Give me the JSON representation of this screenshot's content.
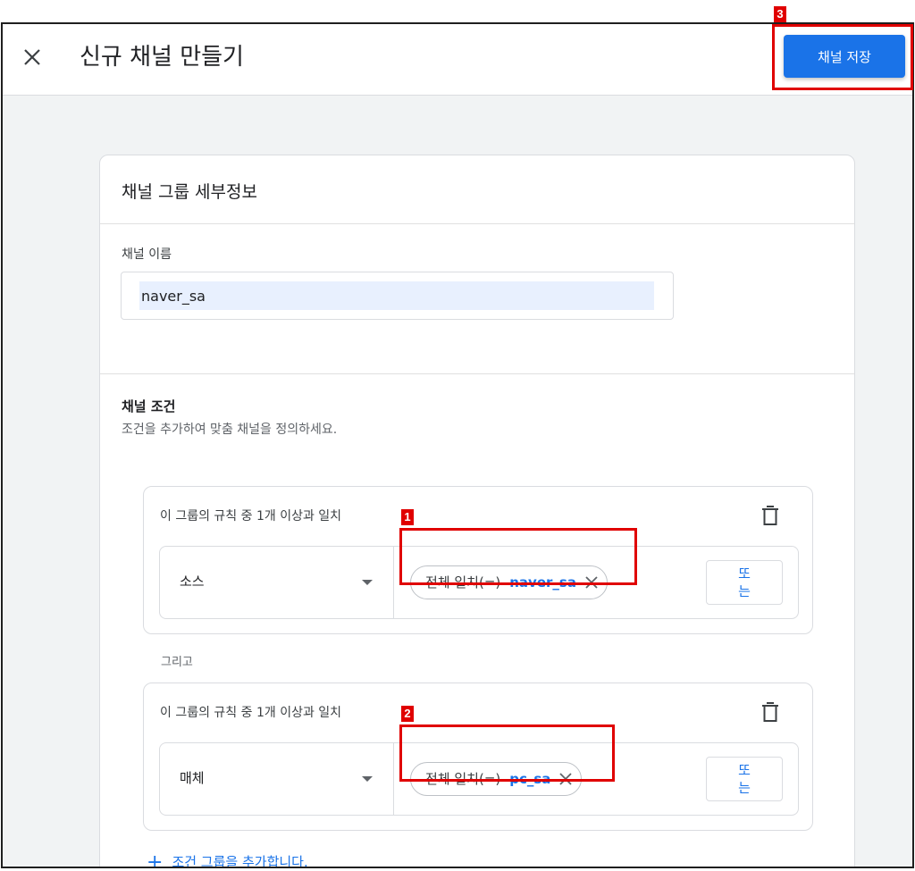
{
  "header": {
    "title": "신규 채널 만들기",
    "save_label": "채널 저장"
  },
  "card": {
    "title": "채널 그룹 세부정보",
    "name_label": "채널 이름",
    "name_value": "naver_sa",
    "conditions_title": "채널 조건",
    "conditions_subtitle": "조건을 추가하여 맞춤 채널을 정의하세요."
  },
  "groups": [
    {
      "title": "이 그룹의 규칙 중 1개 이상과 일치",
      "dimension": "소스",
      "operator": "전체 일치(=)",
      "value": "naver_sa",
      "or_label": "또는"
    },
    {
      "title": "이 그룹의 규칙 중 1개 이상과 일치",
      "dimension": "매체",
      "operator": "전체 일치(=)",
      "value": "pc_sa",
      "or_label": "또는"
    }
  ],
  "and_label": "그리고",
  "add_group_label": "조건 그룹을 추가합니다.",
  "annotations": [
    "1",
    "2",
    "3"
  ],
  "colors": {
    "accent": "#1a73e8",
    "highlight": "#e00000"
  },
  "icons": [
    "close-icon",
    "trash-icon",
    "dropdown-caret-icon",
    "chip-remove-icon",
    "plus-icon"
  ]
}
